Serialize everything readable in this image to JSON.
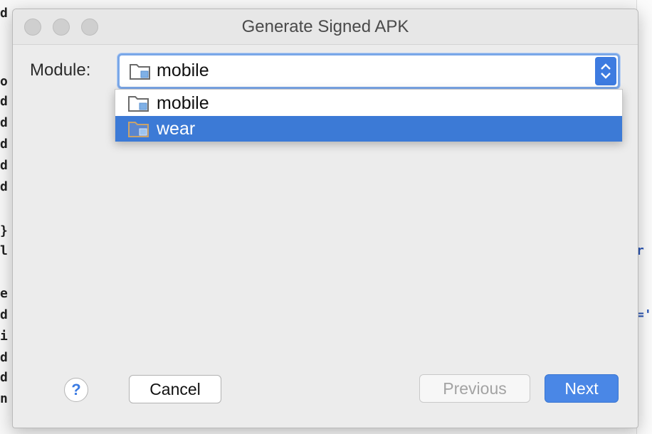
{
  "background": {
    "left_code_glyphs": [
      "d",
      "o",
      "d",
      "d",
      "d",
      "d",
      "d",
      "}",
      "l",
      "e",
      "d",
      "i",
      "d",
      "d",
      "n"
    ],
    "right_code_glyphs": [
      "r",
      "='"
    ]
  },
  "window": {
    "title": "Generate Signed APK",
    "controls": [
      "close",
      "minimize",
      "zoom"
    ]
  },
  "module": {
    "label": "Module:",
    "selected": "mobile",
    "options": [
      {
        "label": "mobile",
        "highlighted": false
      },
      {
        "label": "wear",
        "highlighted": true
      }
    ]
  },
  "buttons": {
    "help": "?",
    "cancel": "Cancel",
    "previous": "Previous",
    "next": "Next"
  },
  "colors": {
    "accent": "#3c7ad6",
    "next_button": "#4a87e6",
    "disabled_text": "#a3a3a3"
  },
  "icons": {
    "module_icon": "folder-module-icon",
    "select_arrows": "updown-chevron-icon"
  }
}
